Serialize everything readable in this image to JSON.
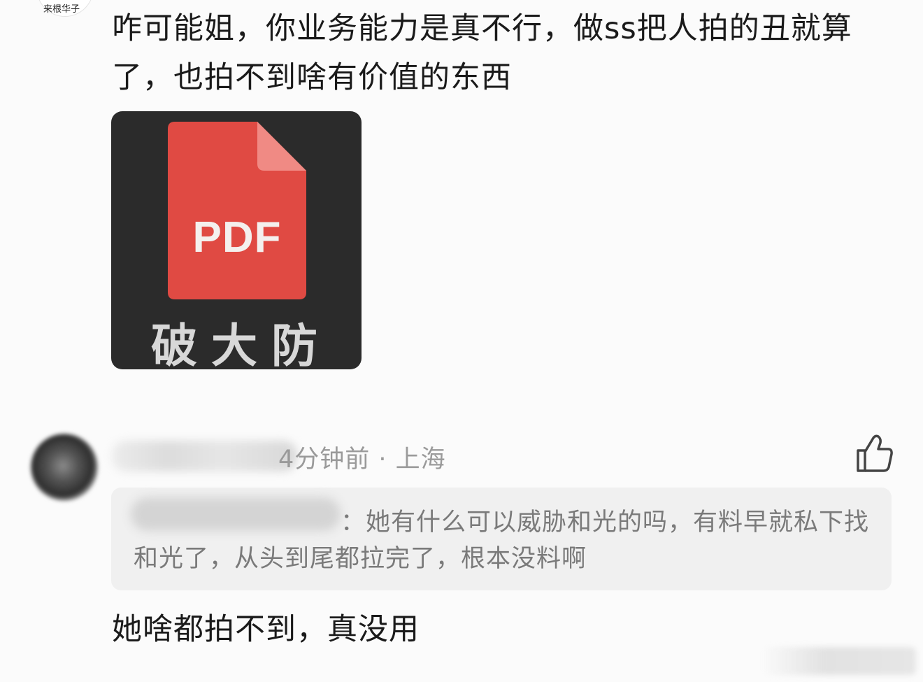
{
  "top_comment": {
    "username": "来根华子",
    "text": "咋可能姐，你业务能力是真不行，做ss把人拍的丑就算了，也拍不到啥有价值的东西",
    "sticker": {
      "label": "PDF",
      "caption": "破大防",
      "color": "#e04a43"
    }
  },
  "second_comment": {
    "meta": "4分钟前 · 上海",
    "quote": {
      "text": "：她有什么可以威胁和光的吗，有料早就私下找和光了，从头到尾都拉完了，根本没料啊"
    },
    "text": "她啥都拍不到，真没用",
    "like_icon": "thumbs-up-icon"
  }
}
